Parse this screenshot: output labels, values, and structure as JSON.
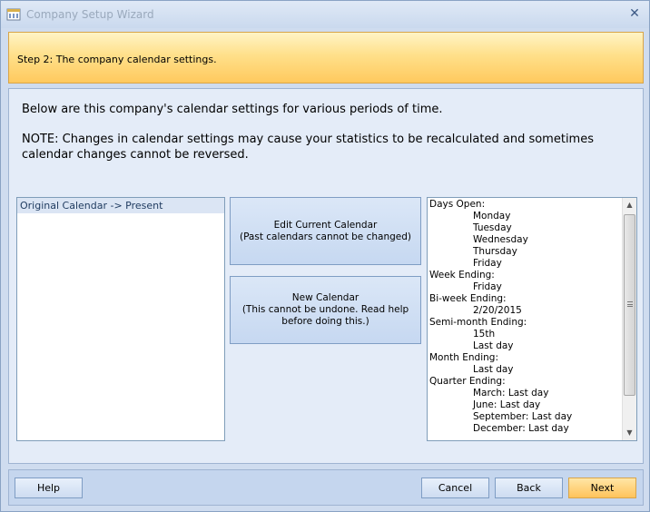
{
  "window": {
    "title": "Company Setup Wizard"
  },
  "banner": {
    "step": "Step 2: The company calendar settings."
  },
  "content": {
    "intro": "Below are this company's calendar settings for various periods of time.",
    "note": "NOTE: Changes in calendar settings may cause your statistics to be recalculated and sometimes calendar changes cannot be reversed."
  },
  "calendar_list": {
    "items": [
      "Original Calendar -> Present"
    ]
  },
  "buttons": {
    "edit_line1": "Edit Current Calendar",
    "edit_line2": "(Past calendars cannot be changed)",
    "new_line1": "New Calendar",
    "new_line2": "(This cannot be undone. Read help",
    "new_line3": "before doing this.)",
    "help": "Help",
    "cancel": "Cancel",
    "back": "Back",
    "next": "Next"
  },
  "details": {
    "lines": [
      {
        "text": "Days Open:",
        "indent": false
      },
      {
        "text": "Monday",
        "indent": true
      },
      {
        "text": "Tuesday",
        "indent": true
      },
      {
        "text": "Wednesday",
        "indent": true
      },
      {
        "text": "Thursday",
        "indent": true
      },
      {
        "text": "Friday",
        "indent": true
      },
      {
        "text": "Week Ending:",
        "indent": false
      },
      {
        "text": "Friday",
        "indent": true
      },
      {
        "text": "Bi-week Ending:",
        "indent": false
      },
      {
        "text": "2/20/2015",
        "indent": true
      },
      {
        "text": "Semi-month Ending:",
        "indent": false
      },
      {
        "text": "15th",
        "indent": true
      },
      {
        "text": "Last day",
        "indent": true
      },
      {
        "text": "Month Ending:",
        "indent": false
      },
      {
        "text": "Last day",
        "indent": true
      },
      {
        "text": "Quarter Ending:",
        "indent": false
      },
      {
        "text": "March: Last day",
        "indent": true
      },
      {
        "text": "June: Last day",
        "indent": true
      },
      {
        "text": "September: Last day",
        "indent": true
      },
      {
        "text": "December: Last day",
        "indent": true
      }
    ]
  },
  "icons": {
    "app": "calendar-app-icon",
    "close": "close-icon"
  }
}
